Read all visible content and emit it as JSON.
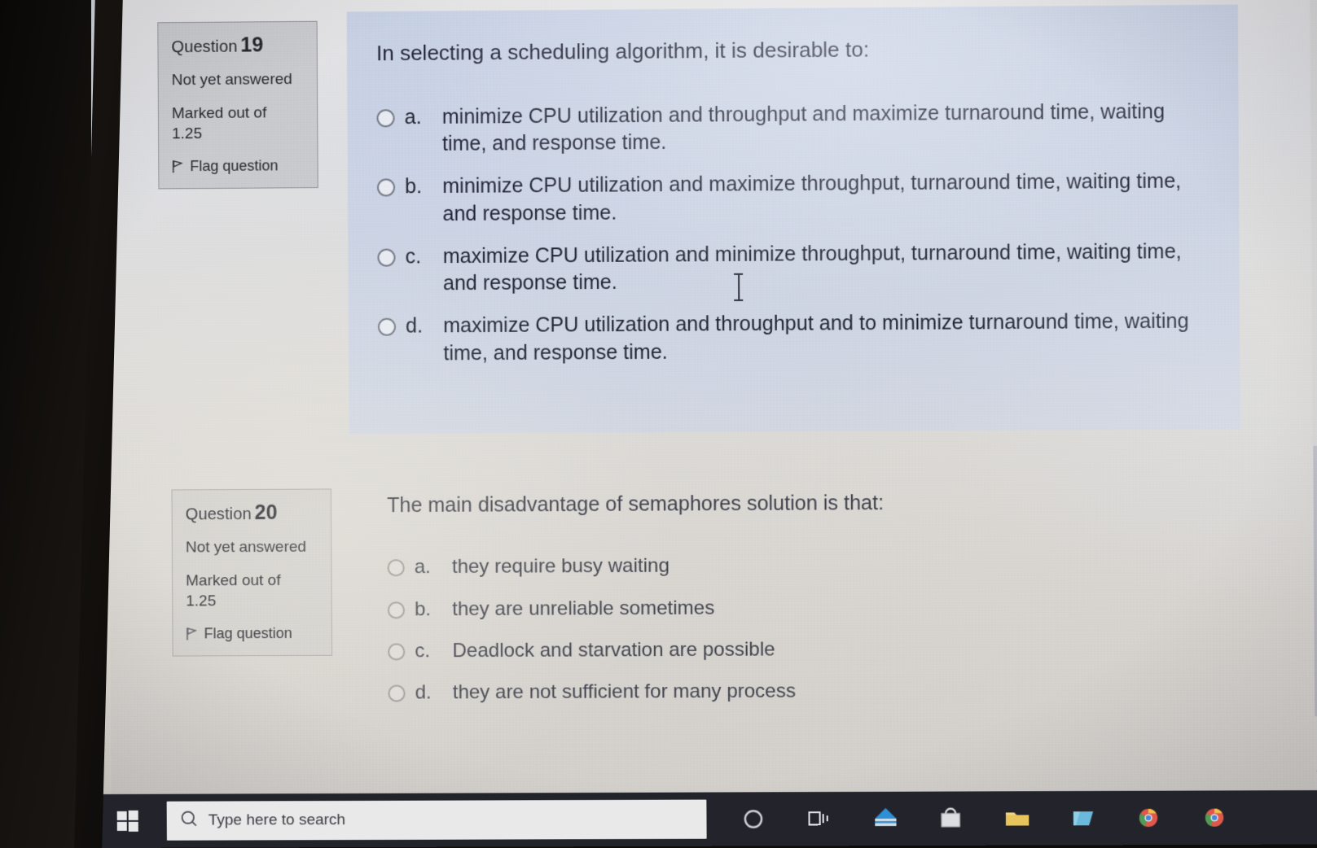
{
  "questions": [
    {
      "id": "q19",
      "info": {
        "label": "Question",
        "number": "19",
        "state": "Not yet answered",
        "marked_label": "Marked out of",
        "marked_value": "1.25",
        "flag_label": "Flag question",
        "flag_icon": "flag-icon"
      },
      "stem": "In selecting a scheduling algorithm, it is desirable to:",
      "options": [
        {
          "letter": "a.",
          "text": "minimize CPU utilization and throughput and maximize turnaround time, waiting time, and response time.",
          "selected": false
        },
        {
          "letter": "b.",
          "text": "minimize CPU utilization and maximize throughput, turnaround time, waiting time, and response time.",
          "selected": false
        },
        {
          "letter": "c.",
          "text": "maximize CPU utilization and minimize throughput, turnaround time, waiting time, and response time.",
          "selected": false
        },
        {
          "letter": "d.",
          "text": "maximize CPU utilization and throughput and to minimize turnaround time, waiting time, and response time.",
          "selected": false
        }
      ]
    },
    {
      "id": "q20",
      "info": {
        "label": "Question",
        "number": "20",
        "state": "Not yet answered",
        "marked_label": "Marked out of",
        "marked_value": "1.25",
        "flag_label": "Flag question",
        "flag_icon": "flag-icon"
      },
      "stem": "The main disadvantage of semaphores solution is that:",
      "options": [
        {
          "letter": "a.",
          "text": "they require busy waiting",
          "selected": false
        },
        {
          "letter": "b.",
          "text": "they are unreliable sometimes",
          "selected": false
        },
        {
          "letter": "c.",
          "text": "Deadlock and starvation are possible",
          "selected": false
        },
        {
          "letter": "d.",
          "text": "they are not sufficient for many process",
          "selected": false
        }
      ]
    }
  ],
  "taskbar": {
    "start_icon": "windows-start-icon",
    "search_placeholder": "Type here to search",
    "search_icon": "search-circle-icon",
    "icons": [
      {
        "name": "cortana-icon"
      },
      {
        "name": "task-view-icon"
      },
      {
        "name": "blue-app-icon"
      },
      {
        "name": "microsoft-store-icon"
      },
      {
        "name": "folder-icon"
      },
      {
        "name": "file-explorer-icon"
      },
      {
        "name": "chrome-icon"
      },
      {
        "name": "chrome-icon-2"
      }
    ]
  },
  "scrollbar": {
    "down_arrow_icon": "chevron-down-icon"
  },
  "colors": {
    "q19_highlight": "#c8d1e3",
    "page_background": "#d8d6d2",
    "infobox_background": "#c6c7cb",
    "text": "#20222c",
    "taskbar": "#23242b"
  }
}
